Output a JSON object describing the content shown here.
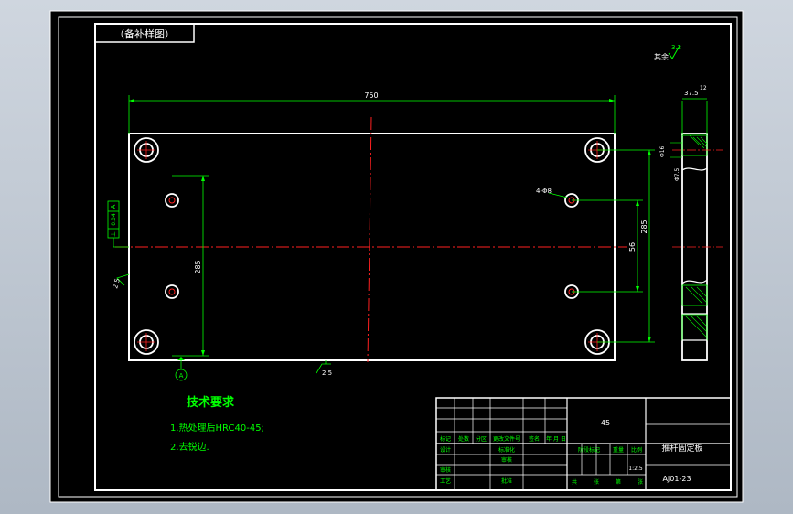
{
  "title_tag": "（备补样图）",
  "roughness_note": {
    "prefix": "其余",
    "value": "3.2"
  },
  "dimensions": {
    "overall_width": "750",
    "height_center": "285",
    "height_right": "285",
    "inner_spacing": "56",
    "hole_callout": "4-Φ8",
    "side_width": "37.5",
    "side_offset": "12",
    "side_phi_top": "Φ16",
    "side_phi_bottom": "Φ7.5",
    "bottom_rough": "2.5",
    "left_rough": "2.5",
    "datum_label": "A",
    "gdt_symbol": "⊥",
    "gdt_value": "0.04",
    "gdt_datum": "A"
  },
  "tech": {
    "title": "技术要求",
    "items": [
      "1.热处理后HRC40-45;",
      "2.去锐边."
    ]
  },
  "title_block": {
    "material": "45",
    "part_name": "推杆固定板",
    "drawing_no": "AJ01-23",
    "scale": "1:2.5",
    "row_labels": [
      "标记",
      "处数",
      "分区",
      "更改文件号",
      "签名",
      "年 月 日"
    ],
    "design": "设计",
    "standardize": "标准化",
    "review": "审核",
    "process": "工艺",
    "approve": "批准",
    "check": "审核",
    "stage_labels": [
      "阶段标记",
      "重量",
      "比例"
    ],
    "sheets": [
      "共",
      "张",
      "第",
      "张"
    ]
  },
  "colors": {
    "line": "#ffffff",
    "dim": "#00ff00",
    "center": "#ff2020",
    "paper": "#000000"
  }
}
